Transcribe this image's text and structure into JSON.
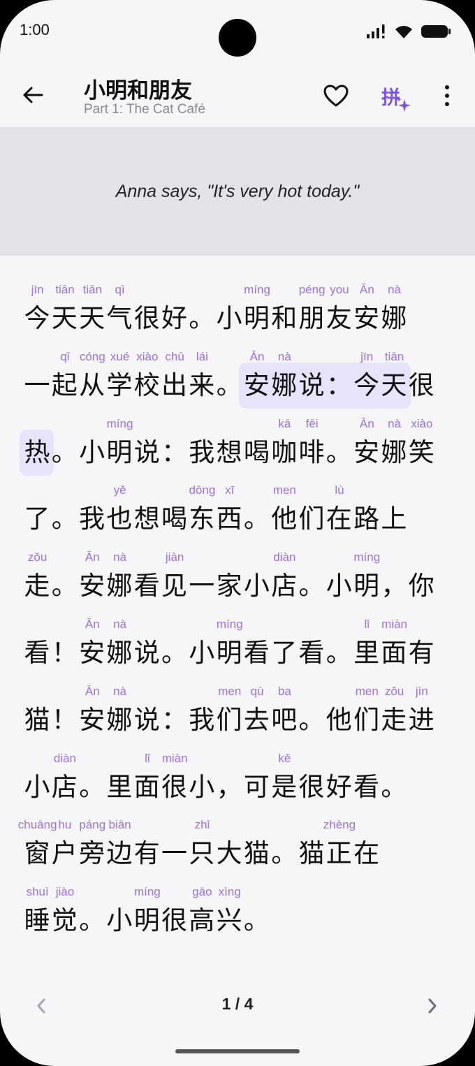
{
  "status": {
    "time": "1:00"
  },
  "header": {
    "title": "小明和朋友",
    "subtitle": "Part 1: The Cat Café",
    "pinyin_toggle_glyph": "拼"
  },
  "translation": {
    "text": "Anna says, \"It's very hot today.\""
  },
  "colors": {
    "accent": "#7c52e8",
    "pinyin": "#9a72e6",
    "highlight": "#e8e3fb",
    "translation_bg": "#e5e1e8",
    "background": "#f6f5f8"
  },
  "lines": [
    {
      "text": "今天天气很好。小明和朋友安娜",
      "pinyin": [
        "jīn",
        "tiān",
        "tiān",
        "qì",
        "",
        "",
        "",
        "",
        "míng",
        "",
        "péng",
        "you",
        "Ān",
        "nà"
      ]
    },
    {
      "text": "一起从学校出来。安娜说：今天很",
      "pinyin": [
        "",
        "qǐ",
        "cóng",
        "xué",
        "xiào",
        "chū",
        "lái",
        "",
        "Ān",
        "nà",
        "",
        "",
        "jīn",
        "tiān",
        ""
      ]
    },
    {
      "text": "热。小明说：我想喝咖啡。安娜笑",
      "pinyin": [
        "",
        "",
        "",
        "míng",
        "",
        "",
        "",
        "",
        "",
        "kā",
        "fēi",
        "",
        "Ān",
        "nà",
        "xiào"
      ]
    },
    {
      "text": "了。我也想喝东西。他们在路上",
      "pinyin": [
        "",
        "",
        "",
        "yě",
        "",
        "",
        "dōng",
        "xī",
        "",
        "men",
        "",
        "lù",
        "",
        ""
      ]
    },
    {
      "text": "走。安娜看见一家小店。小明，你",
      "pinyin": [
        "zǒu",
        "",
        "Ān",
        "nà",
        "",
        "jiàn",
        "",
        "",
        "",
        "diàn",
        "",
        "",
        "míng",
        "",
        ""
      ]
    },
    {
      "text": "看！安娜说。小明看了看。里面有",
      "pinyin": [
        "",
        "",
        "Ān",
        "nà",
        "",
        "",
        "",
        "míng",
        "",
        "",
        "",
        "",
        "lǐ",
        "miàn",
        ""
      ]
    },
    {
      "text": "猫！安娜说：我们去吧。他们走进",
      "pinyin": [
        "",
        "",
        "Ān",
        "nà",
        "",
        "",
        "",
        "men",
        "qù",
        "ba",
        "",
        "",
        "men",
        "zǒu",
        "jìn"
      ]
    },
    {
      "text": "小店。里面很小，可是很好看。",
      "pinyin": [
        "",
        "diàn",
        "",
        "",
        "lǐ",
        "miàn",
        "",
        "",
        "",
        "kě",
        "",
        "",
        "",
        ""
      ]
    },
    {
      "text": "窗户旁边有一只大猫。猫正在",
      "pinyin": [
        "chuāng",
        "hu",
        "páng",
        "biān",
        "",
        "",
        "zhǐ",
        "",
        "",
        "",
        "",
        "zhèng",
        ""
      ]
    },
    {
      "text": "睡觉。小明很高兴。",
      "pinyin": [
        "shuì",
        "jiào",
        "",
        "",
        "míng",
        "",
        "gāo",
        "xìng",
        ""
      ]
    }
  ],
  "highlights": [
    {
      "line": 1,
      "from": 8,
      "to": 14
    },
    {
      "line": 2,
      "from": 0,
      "to": 1
    }
  ],
  "pager": {
    "indicator": "1 / 4"
  }
}
